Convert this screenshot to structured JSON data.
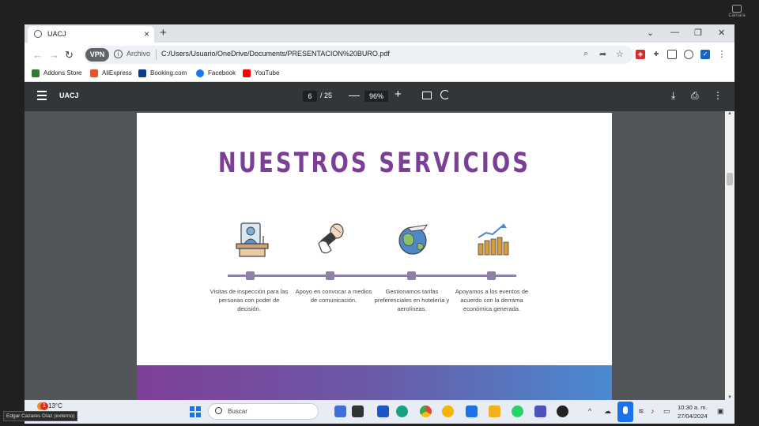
{
  "camera_label": "Cámara",
  "browser": {
    "tab_title": "UACJ",
    "new_tab_symbol": "+",
    "window_buttons": [
      "⌄",
      "—",
      "❐",
      "✕"
    ],
    "address": {
      "vpn_label": "VPN",
      "scheme_label": "Archivo",
      "url": "C:/Users/Usuario/OneDrive/Documents/PRESENTACION%20BURO.pdf"
    },
    "bookmarks": [
      {
        "label": "Addons Store",
        "color": "#2e7d32"
      },
      {
        "label": "AliExpress",
        "color": "#e8532a"
      },
      {
        "label": "Booking.com",
        "color": "#0d3b8c"
      },
      {
        "label": "Facebook",
        "color": "#1877f2"
      },
      {
        "label": "YouTube",
        "color": "#ff0000"
      }
    ]
  },
  "pdf": {
    "title": "UACJ",
    "current_page": "6",
    "total_pages": "/ 25",
    "zoom": "96%"
  },
  "slide": {
    "title": "NUESTROS SERVICIOS",
    "services": [
      {
        "text": "Visitas de inspección para las personas con poder de decisión.",
        "icon": "desk-person-icon"
      },
      {
        "text": "Apoyo en convocar a medios de comunicación.",
        "icon": "microphone-icon"
      },
      {
        "text": "Gestionamos tarifas preferenciales en hotelería y aerolíneas.",
        "icon": "globe-plane-icon"
      },
      {
        "text": "Apoyamos a los eventos de acuerdo con la derrama económica generada.",
        "icon": "coins-growth-icon"
      }
    ],
    "accent_color": "#7b3f98"
  },
  "taskbar": {
    "temperature": "13°C",
    "weather_badge": "1",
    "search_placeholder": "Buscar",
    "time": "10:30 a. m.",
    "date": "27/04/2024",
    "user_label": "Edgar Cazares Díaz (externo)"
  }
}
